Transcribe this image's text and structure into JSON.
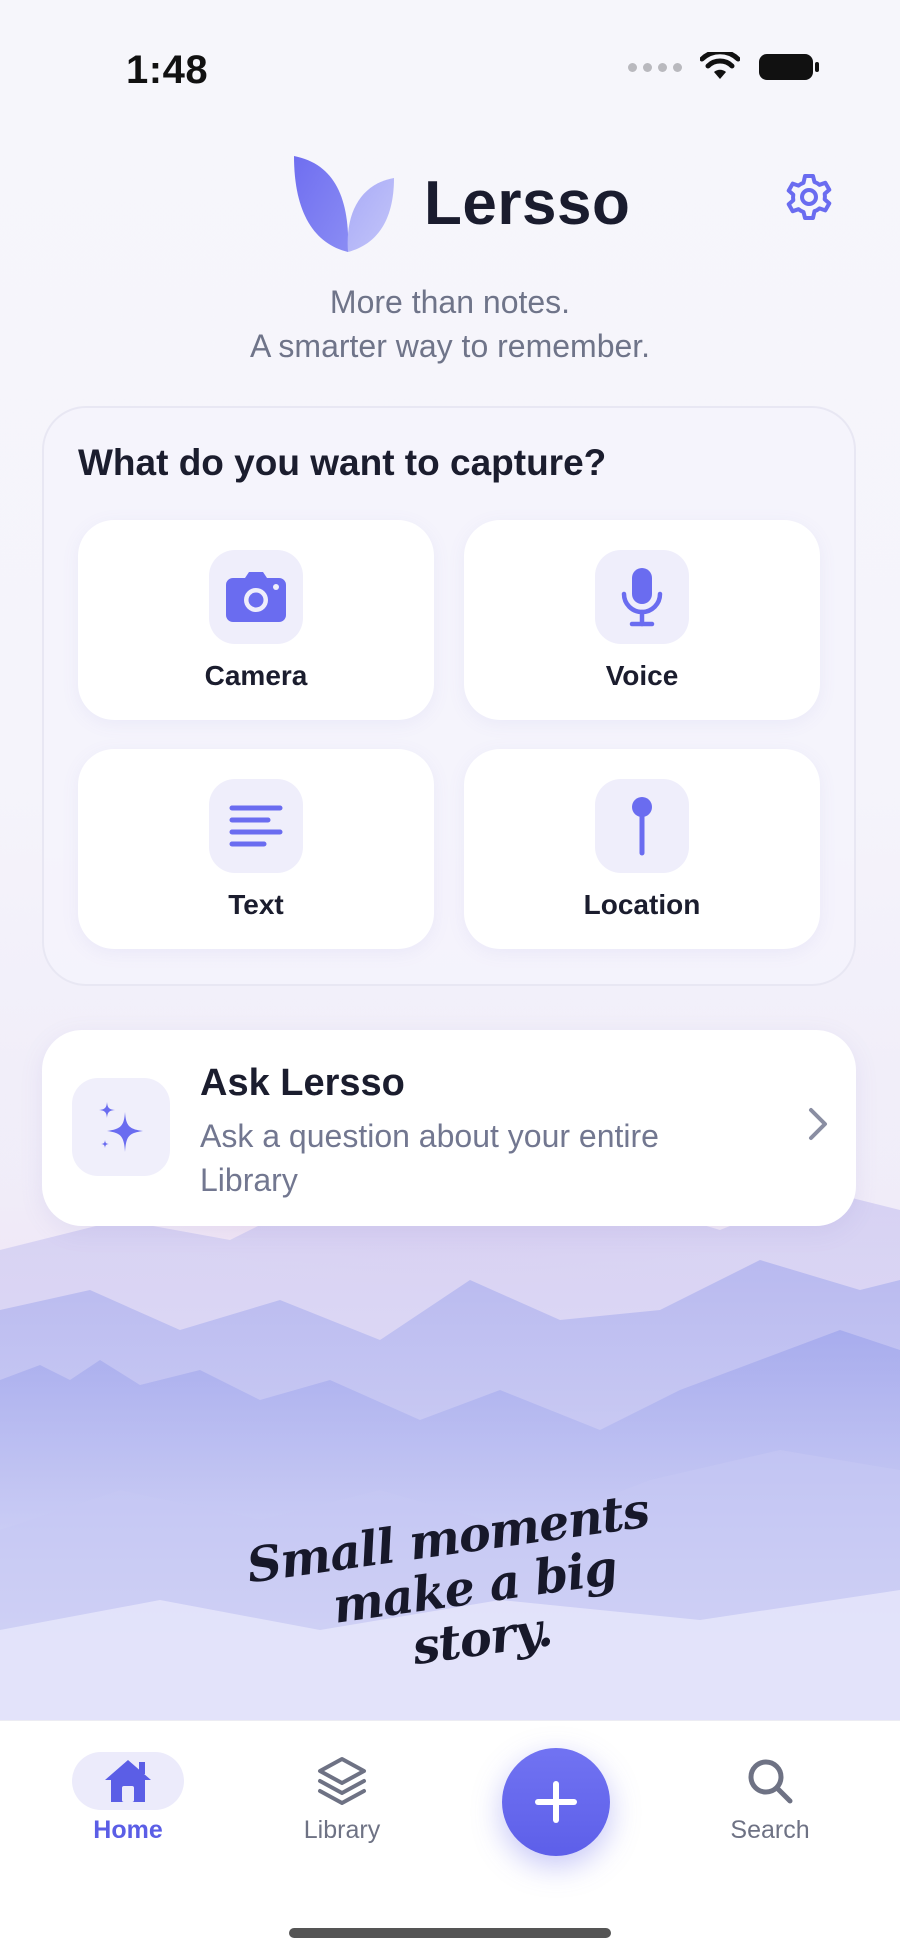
{
  "status_bar": {
    "time": "1:48"
  },
  "header": {
    "app_name": "Lersso",
    "tagline_line1": "More than notes.",
    "tagline_line2": "A smarter way to remember."
  },
  "capture": {
    "title": "What do you want to capture?",
    "options": [
      {
        "label": "Camera",
        "icon": "camera-icon"
      },
      {
        "label": "Voice",
        "icon": "microphone-icon"
      },
      {
        "label": "Text",
        "icon": "text-lines-icon"
      },
      {
        "label": "Location",
        "icon": "pin-icon"
      }
    ]
  },
  "ask": {
    "title": "Ask Lersso",
    "subtitle": "Ask a question about your entire Library",
    "icon": "sparkles-icon"
  },
  "script_tagline": {
    "line1": "Small moments",
    "line2": "make a big story."
  },
  "nav": {
    "items": [
      {
        "label": "Home",
        "icon": "home-icon",
        "active": true
      },
      {
        "label": "Library",
        "icon": "layers-icon",
        "active": false
      },
      {
        "label": "Search",
        "icon": "search-icon",
        "active": false
      }
    ],
    "fab_icon": "plus-icon"
  },
  "colors": {
    "accent": "#5b5ee6",
    "text_primary": "#1b1d2e",
    "text_secondary": "#6f7489",
    "mountain_tint": "#a9aef0"
  }
}
